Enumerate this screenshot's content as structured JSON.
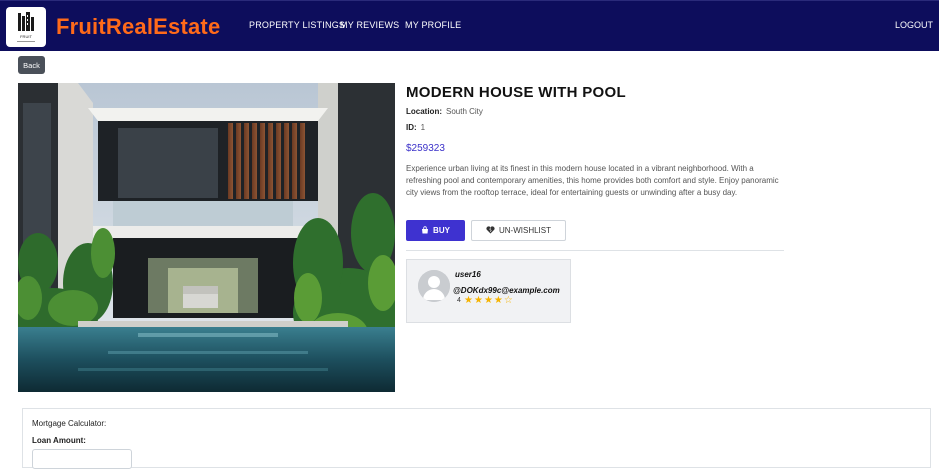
{
  "navbar": {
    "brand": "FruitRealEstate",
    "links": [
      "PROPERTY LISTINGS",
      "MY REVIEWS",
      "MY PROFILE"
    ],
    "logout": "LOGOUT",
    "logo_text": "FRUIT"
  },
  "back_label": "Back",
  "property": {
    "title": "MODERN HOUSE WITH POOL",
    "location_label": "Location:",
    "location": "South City",
    "id_label": "ID:",
    "id": "1",
    "price": "$259323",
    "description": "Experience urban living at its finest in this modern house located in a vibrant neighborhood. With a refreshing pool and contemporary amenities, this home provides both comfort and style. Enjoy panoramic city views from the rooftop terrace, ideal for entertaining guests or unwinding after a busy day."
  },
  "actions": {
    "buy_label": "BUY",
    "wishlist_label": "UN-WISHLIST"
  },
  "review": {
    "username": "user16",
    "email": "@DOKdx99c@example.com",
    "rating": "4",
    "stars_filled": 4,
    "stars_total": 5
  },
  "mortgage": {
    "title": "Mortgage Calculator:",
    "loan_label": "Loan Amount:",
    "loan_value": ""
  },
  "colors": {
    "navbar": "#0d0d5c",
    "brand": "#ff6a1a",
    "accent": "#3e32d0",
    "star": "#f5b301"
  }
}
